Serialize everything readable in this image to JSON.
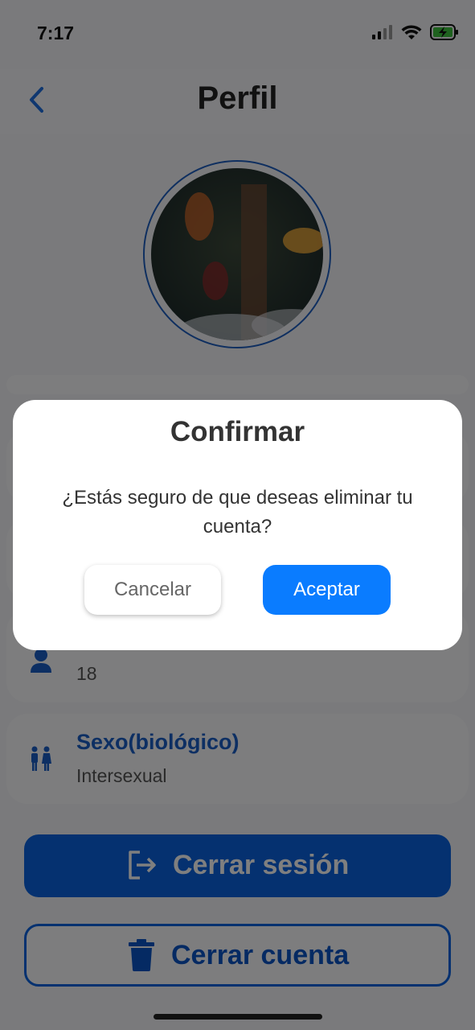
{
  "status_bar": {
    "time": "7:17"
  },
  "header": {
    "title": "Perfil"
  },
  "profile_cards": [
    {
      "value": "18"
    },
    {
      "label": "Sexo(biológico)",
      "value": "Intersexual"
    }
  ],
  "actions": {
    "logout_label": "Cerrar sesión",
    "close_account_label": "Cerrar cuenta"
  },
  "dialog": {
    "title": "Confirmar",
    "message": "¿Estás seguro de que deseas eliminar tu cuenta?",
    "cancel_label": "Cancelar",
    "accept_label": "Aceptar"
  },
  "colors": {
    "primary": "#0a63e0",
    "accept": "#0a7cff",
    "label": "#1a5fc7"
  }
}
